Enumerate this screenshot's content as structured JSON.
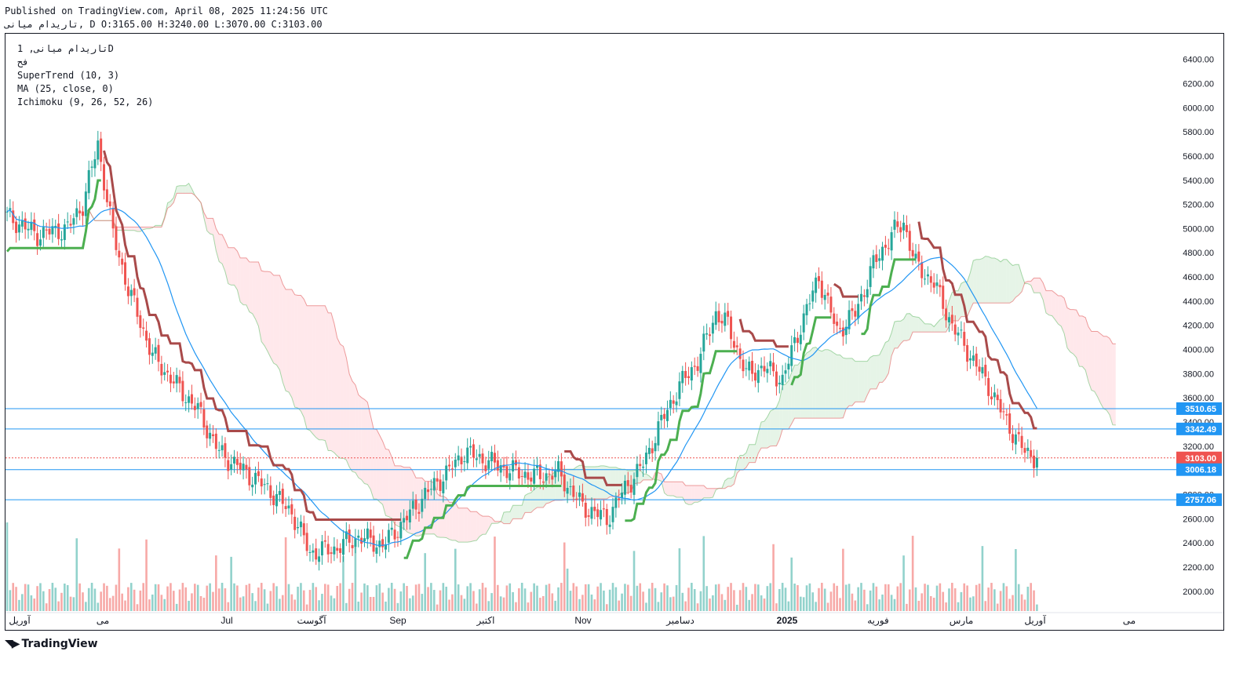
{
  "header": {
    "published": "Published on TradingView.com, April 08, 2025 11:24:56 UTC",
    "symbol_line": "تاریدام میانی, D O:3165.00 H:3240.00 L:3070.00 C:3103.00"
  },
  "legend": {
    "symbol": "تاریدام میانی, 1D",
    "exchange": "فح",
    "supertrend": "SuperTrend (10, 3)",
    "ma": "MA (25, close, 0)",
    "ichimoku": "Ichimoku (9, 26, 52, 26)"
  },
  "footer": {
    "logo_text": "TradingView"
  },
  "colors": {
    "up": "#26a69a",
    "down": "#ef5350",
    "supertrend_up": "#4caf50",
    "supertrend_down": "#a94a4a",
    "ma": "#2196f3",
    "cloud_bull": "#c8e6c9",
    "cloud_bear": "#ffcdd2",
    "hline": "#2196f3"
  },
  "chart_data": {
    "type": "candlestick",
    "y_axis": {
      "ticks": [
        2000,
        2200,
        2400,
        2600,
        2800,
        3000,
        3200,
        3400,
        3600,
        3800,
        4000,
        4200,
        4400,
        4600,
        4800,
        5000,
        5200,
        5400,
        5600,
        5800,
        6000,
        6200,
        6400
      ],
      "ylim": [
        1940,
        6560
      ]
    },
    "x_axis": {
      "labels": [
        "آوریل",
        "می",
        "Jul",
        "آگوست",
        "Sep",
        "اکتبر",
        "Nov",
        "دسامبر",
        "2025",
        "فوریه",
        "مارس",
        "آوریل",
        "می"
      ]
    },
    "horizontal_levels": [
      {
        "value": 3510.65,
        "label": "3510.65",
        "color": "#2196f3"
      },
      {
        "value": 3342.49,
        "label": "3342.49",
        "color": "#2196f3"
      },
      {
        "value": 3103.0,
        "label": "3103.00",
        "color": "#ef5350"
      },
      {
        "value": 3006.18,
        "label": "3006.18",
        "color": "#2196f3"
      },
      {
        "value": 2757.06,
        "label": "2757.06",
        "color": "#2196f3"
      }
    ],
    "last_price": {
      "open": 3165.0,
      "high": 3240.0,
      "low": 3070.0,
      "close": 3103.0
    },
    "close_series": [
      {
        "i": 0,
        "c": 5100
      },
      {
        "i": 10,
        "c": 4950
      },
      {
        "i": 20,
        "c": 5000
      },
      {
        "i": 25,
        "c": 5200
      },
      {
        "i": 30,
        "c": 5700
      },
      {
        "i": 32,
        "c": 5400
      },
      {
        "i": 35,
        "c": 4950
      },
      {
        "i": 40,
        "c": 4500
      },
      {
        "i": 48,
        "c": 3950
      },
      {
        "i": 56,
        "c": 3700
      },
      {
        "i": 63,
        "c": 3500
      },
      {
        "i": 70,
        "c": 3150
      },
      {
        "i": 78,
        "c": 3000
      },
      {
        "i": 86,
        "c": 2850
      },
      {
        "i": 94,
        "c": 2650
      },
      {
        "i": 100,
        "c": 2320
      },
      {
        "i": 108,
        "c": 2350
      },
      {
        "i": 116,
        "c": 2450
      },
      {
        "i": 124,
        "c": 2380
      },
      {
        "i": 130,
        "c": 2550
      },
      {
        "i": 138,
        "c": 2800
      },
      {
        "i": 146,
        "c": 3000
      },
      {
        "i": 151,
        "c": 3150
      },
      {
        "i": 158,
        "c": 3080
      },
      {
        "i": 166,
        "c": 3000
      },
      {
        "i": 174,
        "c": 2950
      },
      {
        "i": 182,
        "c": 2980
      },
      {
        "i": 190,
        "c": 2700
      },
      {
        "i": 198,
        "c": 2600
      },
      {
        "i": 204,
        "c": 2850
      },
      {
        "i": 210,
        "c": 3050
      },
      {
        "i": 216,
        "c": 3400
      },
      {
        "i": 222,
        "c": 3700
      },
      {
        "i": 228,
        "c": 3900
      },
      {
        "i": 234,
        "c": 4300
      },
      {
        "i": 238,
        "c": 4200
      },
      {
        "i": 244,
        "c": 3800
      },
      {
        "i": 250,
        "c": 3850
      },
      {
        "i": 256,
        "c": 3750
      },
      {
        "i": 262,
        "c": 4200
      },
      {
        "i": 268,
        "c": 4600
      },
      {
        "i": 274,
        "c": 4150
      },
      {
        "i": 280,
        "c": 4300
      },
      {
        "i": 286,
        "c": 4700
      },
      {
        "i": 292,
        "c": 4950
      },
      {
        "i": 296,
        "c": 5050
      },
      {
        "i": 300,
        "c": 4700
      },
      {
        "i": 306,
        "c": 4550
      },
      {
        "i": 312,
        "c": 4200
      },
      {
        "i": 318,
        "c": 3950
      },
      {
        "i": 324,
        "c": 3700
      },
      {
        "i": 330,
        "c": 3400
      },
      {
        "i": 336,
        "c": 3150
      },
      {
        "i": 340,
        "c": 3103
      }
    ]
  }
}
